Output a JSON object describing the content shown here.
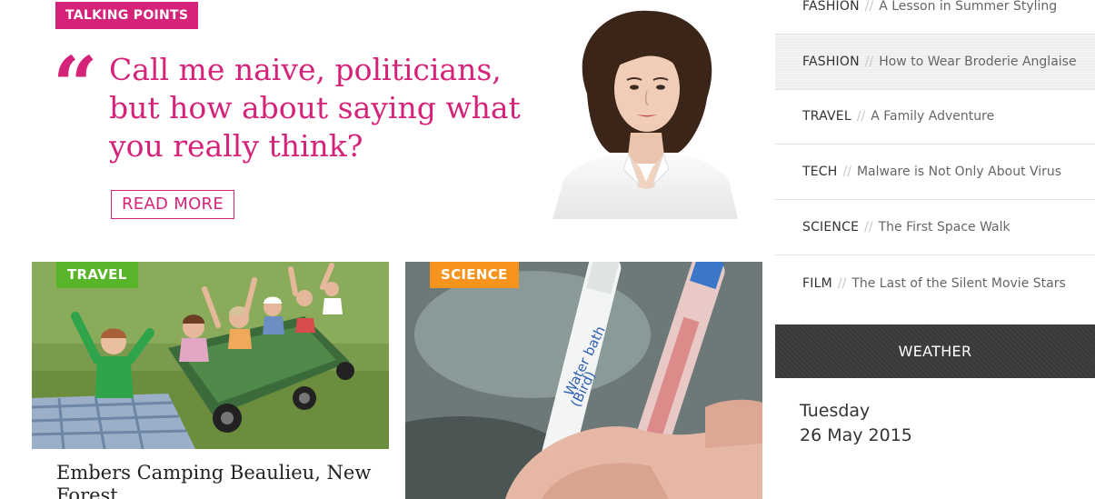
{
  "talking_points": {
    "badge": "TALKING POINTS",
    "quote_mark": "“",
    "quote": "Call me naive, politicians, but how about saying what you really think?",
    "read_more": "READ MORE"
  },
  "cards": [
    {
      "category": "TRAVEL",
      "title": "Embers Camping Beaulieu, New Forest"
    },
    {
      "category": "SCIENCE",
      "title": ""
    }
  ],
  "sidebar": {
    "separator": "//",
    "items": [
      {
        "category": "FASHION",
        "title": "A Lesson in Summer Styling"
      },
      {
        "category": "FASHION",
        "title": "How to Wear Broderie Anglaise"
      },
      {
        "category": "TRAVEL",
        "title": "A Family Adventure"
      },
      {
        "category": "TECH",
        "title": "Malware is Not Only About Virus"
      },
      {
        "category": "SCIENCE",
        "title": "The First Space Walk"
      },
      {
        "category": "FILM",
        "title": "The Last of the Silent Movie Stars"
      }
    ]
  },
  "weather": {
    "heading": "WEATHER",
    "day": "Tuesday",
    "date": "26 May 2015"
  },
  "colors": {
    "accent_pink": "#d6237a",
    "travel_green": "#58b52a",
    "science_orange": "#f7941d",
    "weather_bar": "#3a3a3a"
  }
}
